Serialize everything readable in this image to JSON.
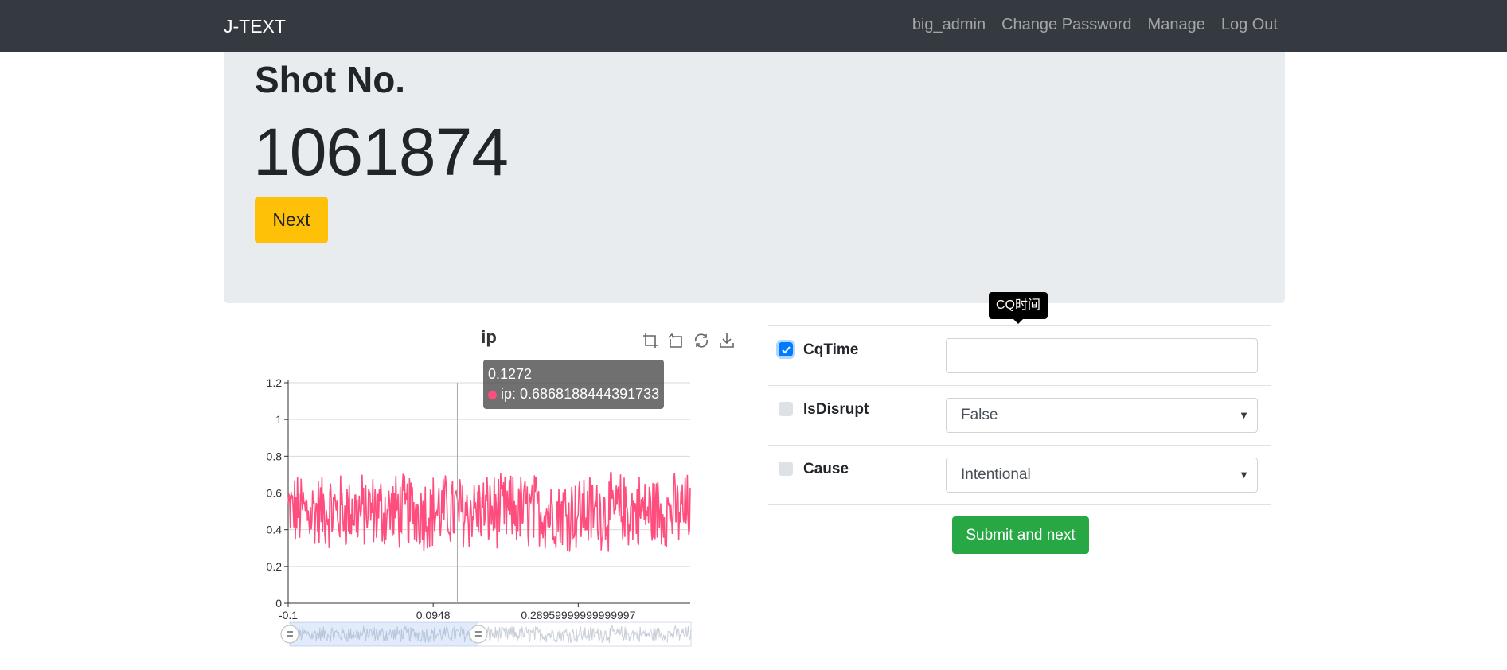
{
  "navbar": {
    "brand": "J-TEXT",
    "links": [
      "big_admin",
      "Change Password",
      "Manage",
      "Log Out"
    ]
  },
  "jumbotron": {
    "heading": "Shot No.",
    "shot_number": "1061874",
    "next_label": "Next"
  },
  "chart": {
    "title": "ip",
    "tooltip_x": "0.1272",
    "tooltip_series": "ip: 0.6868188444391733",
    "toolbox_icons": [
      "zoom-icon",
      "zoom-reset-icon",
      "restore-icon",
      "save-image-icon"
    ]
  },
  "chart_data": {
    "type": "line",
    "title": "ip",
    "xlabel": "",
    "ylabel": "",
    "x_range": [
      -0.1,
      0.44
    ],
    "x_tick_labels": [
      "-0.1",
      "0.0948",
      "0.28959999999999997"
    ],
    "ylim": [
      0,
      1.2
    ],
    "y_ticks": [
      0,
      0.2,
      0.4,
      0.6,
      0.8,
      1,
      1.2
    ],
    "grid": true,
    "series": [
      {
        "color": "#ff4d7e",
        "description": "noisy signal fluctuating roughly between 0.25 and 0.71 around a mean of ~0.5 across the whole visible range"
      }
    ],
    "highlighted_point": {
      "x": 0.1272,
      "y": 0.6868188444391733
    },
    "data_zoom": {
      "start_fraction": 0.0,
      "end_fraction": 0.47
    }
  },
  "form": {
    "tooltip": "CQ时间",
    "rows": [
      {
        "label": "CqTime",
        "checked": true,
        "value": ""
      },
      {
        "label": "IsDisrupt",
        "checked": false,
        "value": "False"
      },
      {
        "label": "Cause",
        "checked": false,
        "value": "Intentional"
      }
    ],
    "submit_label": "Submit and next"
  },
  "colors": {
    "navbar": "#343a40",
    "jumbotron": "#e9ecef",
    "next_button": "#ffc107",
    "submit_button": "#28a745",
    "series": "#ff4d7e",
    "checkbox_checked": "#007bff"
  }
}
